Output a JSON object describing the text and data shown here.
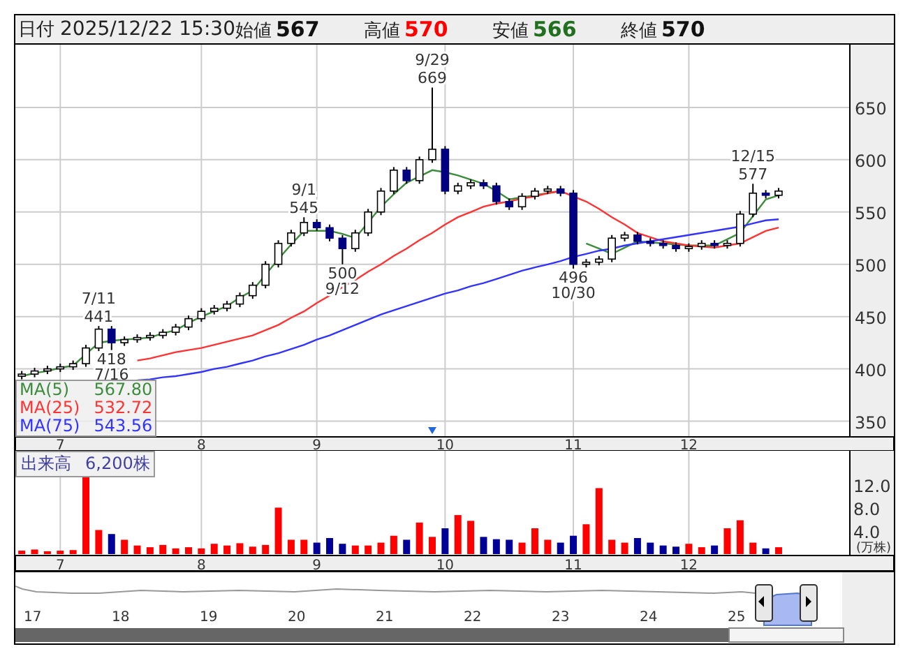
{
  "header": {
    "date_label": "日付",
    "datetime": "2025/12/22 15:30",
    "quotes": [
      {
        "label": "始値",
        "value": "567",
        "color": "#111111"
      },
      {
        "label": "高値",
        "value": "570",
        "color": "#ff0000"
      },
      {
        "label": "安値",
        "value": "566",
        "color": "#207020"
      },
      {
        "label": "終値",
        "value": "570",
        "color": "#111111"
      }
    ]
  },
  "price_chart": {
    "chart_data": {
      "type": "candlestick",
      "ylim": [
        335,
        710
      ],
      "categories": [
        null,
        null,
        null,
        "7",
        null,
        null,
        null,
        null,
        null,
        null,
        null,
        null,
        null,
        null,
        "8",
        null,
        null,
        null,
        null,
        null,
        null,
        null,
        null,
        "9",
        null,
        null,
        null,
        null,
        null,
        null,
        null,
        null,
        null,
        "10",
        null,
        null,
        null,
        null,
        null,
        null,
        null,
        null,
        null,
        "11",
        null,
        null,
        null,
        null,
        null,
        null,
        null,
        null,
        "12",
        null,
        null,
        null,
        null,
        null,
        null,
        null
      ],
      "ohlc": [
        [
          393,
          398,
          390,
          395
        ],
        [
          395,
          401,
          392,
          398
        ],
        [
          398,
          403,
          395,
          400
        ],
        [
          400,
          405,
          397,
          402
        ],
        [
          402,
          408,
          399,
          405
        ],
        [
          405,
          423,
          402,
          420
        ],
        [
          420,
          441,
          417,
          438
        ],
        [
          438,
          441,
          418,
          425
        ],
        [
          425,
          431,
          422,
          428
        ],
        [
          428,
          433,
          425,
          430
        ],
        [
          430,
          435,
          427,
          432
        ],
        [
          432,
          438,
          429,
          435
        ],
        [
          435,
          443,
          432,
          440
        ],
        [
          440,
          451,
          437,
          448
        ],
        [
          448,
          458,
          445,
          455
        ],
        [
          455,
          461,
          452,
          458
        ],
        [
          458,
          465,
          455,
          462
        ],
        [
          462,
          473,
          459,
          470
        ],
        [
          470,
          483,
          467,
          480
        ],
        [
          480,
          503,
          477,
          500
        ],
        [
          500,
          523,
          497,
          520
        ],
        [
          520,
          533,
          517,
          530
        ],
        [
          530,
          545,
          527,
          540
        ],
        [
          540,
          543,
          532,
          535
        ],
        [
          535,
          538,
          522,
          525
        ],
        [
          525,
          528,
          500,
          515
        ],
        [
          515,
          533,
          512,
          530
        ],
        [
          530,
          553,
          527,
          550
        ],
        [
          550,
          573,
          547,
          570
        ],
        [
          570,
          593,
          567,
          590
        ],
        [
          590,
          593,
          577,
          580
        ],
        [
          580,
          603,
          577,
          600
        ],
        [
          600,
          669,
          597,
          610
        ],
        [
          610,
          613,
          567,
          570
        ],
        [
          570,
          578,
          567,
          575
        ],
        [
          575,
          581,
          572,
          578
        ],
        [
          578,
          581,
          572,
          575
        ],
        [
          575,
          578,
          557,
          560
        ],
        [
          560,
          563,
          552,
          555
        ],
        [
          555,
          568,
          552,
          565
        ],
        [
          565,
          573,
          562,
          570
        ],
        [
          570,
          575,
          567,
          572
        ],
        [
          572,
          575,
          565,
          568
        ],
        [
          568,
          571,
          496,
          500
        ],
        [
          500,
          505,
          497,
          502
        ],
        [
          502,
          508,
          499,
          505
        ],
        [
          505,
          528,
          502,
          525
        ],
        [
          525,
          531,
          522,
          528
        ],
        [
          528,
          531,
          519,
          522
        ],
        [
          522,
          525,
          517,
          520
        ],
        [
          520,
          523,
          515,
          518
        ],
        [
          518,
          521,
          512,
          515
        ],
        [
          515,
          520,
          512,
          517
        ],
        [
          517,
          523,
          514,
          520
        ],
        [
          520,
          523,
          515,
          518
        ],
        [
          518,
          523,
          515,
          520
        ],
        [
          520,
          551,
          517,
          548
        ],
        [
          548,
          577,
          545,
          568
        ],
        [
          568,
          571,
          563,
          566
        ],
        [
          566,
          573,
          563,
          570
        ]
      ],
      "yticks": [
        350,
        400,
        450,
        500,
        550,
        600,
        650
      ]
    },
    "moving_averages": {
      "legend_values": [
        "567.80",
        "532.72",
        "543.56"
      ],
      "chart_data": {
        "type": "line",
        "grid": true,
        "ylim": [
          335,
          710
        ],
        "categories": [
          null,
          null,
          null,
          null,
          null,
          null,
          null,
          null,
          null,
          null,
          null,
          null,
          null,
          null,
          null,
          null,
          null,
          null,
          null,
          null,
          null,
          null,
          null,
          null,
          null,
          null,
          null,
          null,
          null,
          null,
          null,
          null,
          null,
          null,
          null,
          null,
          null,
          null,
          null,
          null,
          null,
          null,
          null,
          null,
          null,
          null,
          null,
          null,
          null,
          null,
          null,
          null,
          null,
          null,
          null,
          null,
          null,
          null,
          null,
          null
        ],
        "series": [
          {
            "name": "MA(5)",
            "color": "#3c8c3c",
            "values": [
              393,
              396,
              398,
              401,
              403,
              414,
              425,
              427,
              428,
              429,
              430,
              434,
              437,
              444,
              450,
              455,
              460,
              468,
              475,
              490,
              505,
              519,
              532,
              532,
              532,
              529,
              525,
              540,
              555,
              567,
              578,
              584,
              590,
              588,
              585,
              581,
              577,
              570,
              562,
              564,
              566,
              568,
              570,
              null,
              520,
              515,
              510,
              516,
              522,
              521,
              520,
              519,
              518,
              518,
              518,
              524,
              530,
              546,
              562,
              566
            ]
          },
          {
            "name": "MA(25)",
            "color": "#ff3333",
            "values": [
              null,
              null,
              null,
              null,
              null,
              null,
              null,
              null,
              null,
              408,
              410,
              413,
              416,
              418,
              420,
              423,
              426,
              429,
              432,
              437,
              442,
              449,
              455,
              463,
              470,
              478,
              485,
              493,
              500,
              508,
              515,
              523,
              530,
              538,
              545,
              550,
              555,
              558,
              560,
              563,
              565,
              568,
              570,
              565,
              560,
              553,
              545,
              538,
              530,
              526,
              522,
              520,
              518,
              517,
              516,
              518,
              520,
              526,
              532,
              535
            ]
          },
          {
            "name": "MA(75)",
            "color": "#3333ff",
            "values": [
              null,
              null,
              null,
              null,
              null,
              null,
              null,
              null,
              null,
              389,
              390,
              392,
              393,
              395,
              397,
              400,
              402,
              405,
              408,
              412,
              415,
              419,
              423,
              428,
              432,
              437,
              442,
              447,
              452,
              456,
              460,
              464,
              468,
              472,
              475,
              479,
              482,
              486,
              490,
              494,
              497,
              500,
              503,
              507,
              510,
              513,
              515,
              518,
              520,
              522,
              524,
              526,
              528,
              530,
              532,
              534,
              536,
              539,
              542,
              543
            ]
          }
        ]
      }
    },
    "callouts": [
      {
        "date": "7/11",
        "price": "441"
      },
      {
        "date": "7/16",
        "price": "418"
      },
      {
        "date": "9/1",
        "price": "545"
      },
      {
        "date": "9/12",
        "price": "500"
      },
      {
        "date": "9/29",
        "price": "669"
      },
      {
        "date": "10/30",
        "price": "496"
      },
      {
        "date": "12/15",
        "price": "577"
      }
    ]
  },
  "volume_chart": {
    "title": "出来高",
    "reading": "6,200株",
    "chart_data": {
      "type": "bar",
      "grid": true,
      "ylim": [
        0,
        18
      ],
      "ylabel": "(万株)",
      "categories": [
        null,
        null,
        null,
        "7",
        null,
        null,
        null,
        null,
        null,
        null,
        null,
        null,
        null,
        null,
        "8",
        null,
        null,
        null,
        null,
        null,
        null,
        null,
        null,
        "9",
        null,
        null,
        null,
        null,
        null,
        null,
        null,
        null,
        null,
        "10",
        null,
        null,
        null,
        null,
        null,
        null,
        null,
        null,
        null,
        "11",
        null,
        null,
        null,
        null,
        null,
        null,
        null,
        null,
        "12",
        null,
        null,
        null,
        null,
        null,
        null,
        null
      ],
      "values": [
        0.6,
        0.8,
        0.5,
        0.6,
        0.7,
        13.5,
        4.2,
        3.5,
        2.5,
        1.5,
        1.2,
        1.6,
        1.0,
        1.2,
        1.0,
        1.8,
        1.5,
        1.9,
        1.3,
        1.6,
        8.1,
        2.5,
        2.5,
        2.0,
        2.8,
        1.8,
        1.5,
        1.5,
        2.0,
        3.2,
        2.5,
        5.5,
        3.0,
        4.5,
        6.8,
        5.8,
        3.0,
        2.6,
        2.5,
        2.0,
        4.5,
        2.5,
        2.0,
        3.2,
        5.2,
        11.5,
        2.5,
        2.0,
        2.8,
        2.0,
        1.5,
        1.3,
        1.8,
        1.2,
        1.5,
        4.5,
        5.9,
        2.0,
        1.0,
        1.2
      ],
      "yticks": [
        {
          "value": 4,
          "label": "4.0"
        },
        {
          "value": 8,
          "label": "8.0"
        },
        {
          "value": 12,
          "label": "12.0"
        }
      ]
    }
  },
  "navigator": {
    "years": [
      "17",
      "18",
      "19",
      "20",
      "21",
      "22",
      "23",
      "24",
      "25"
    ]
  }
}
